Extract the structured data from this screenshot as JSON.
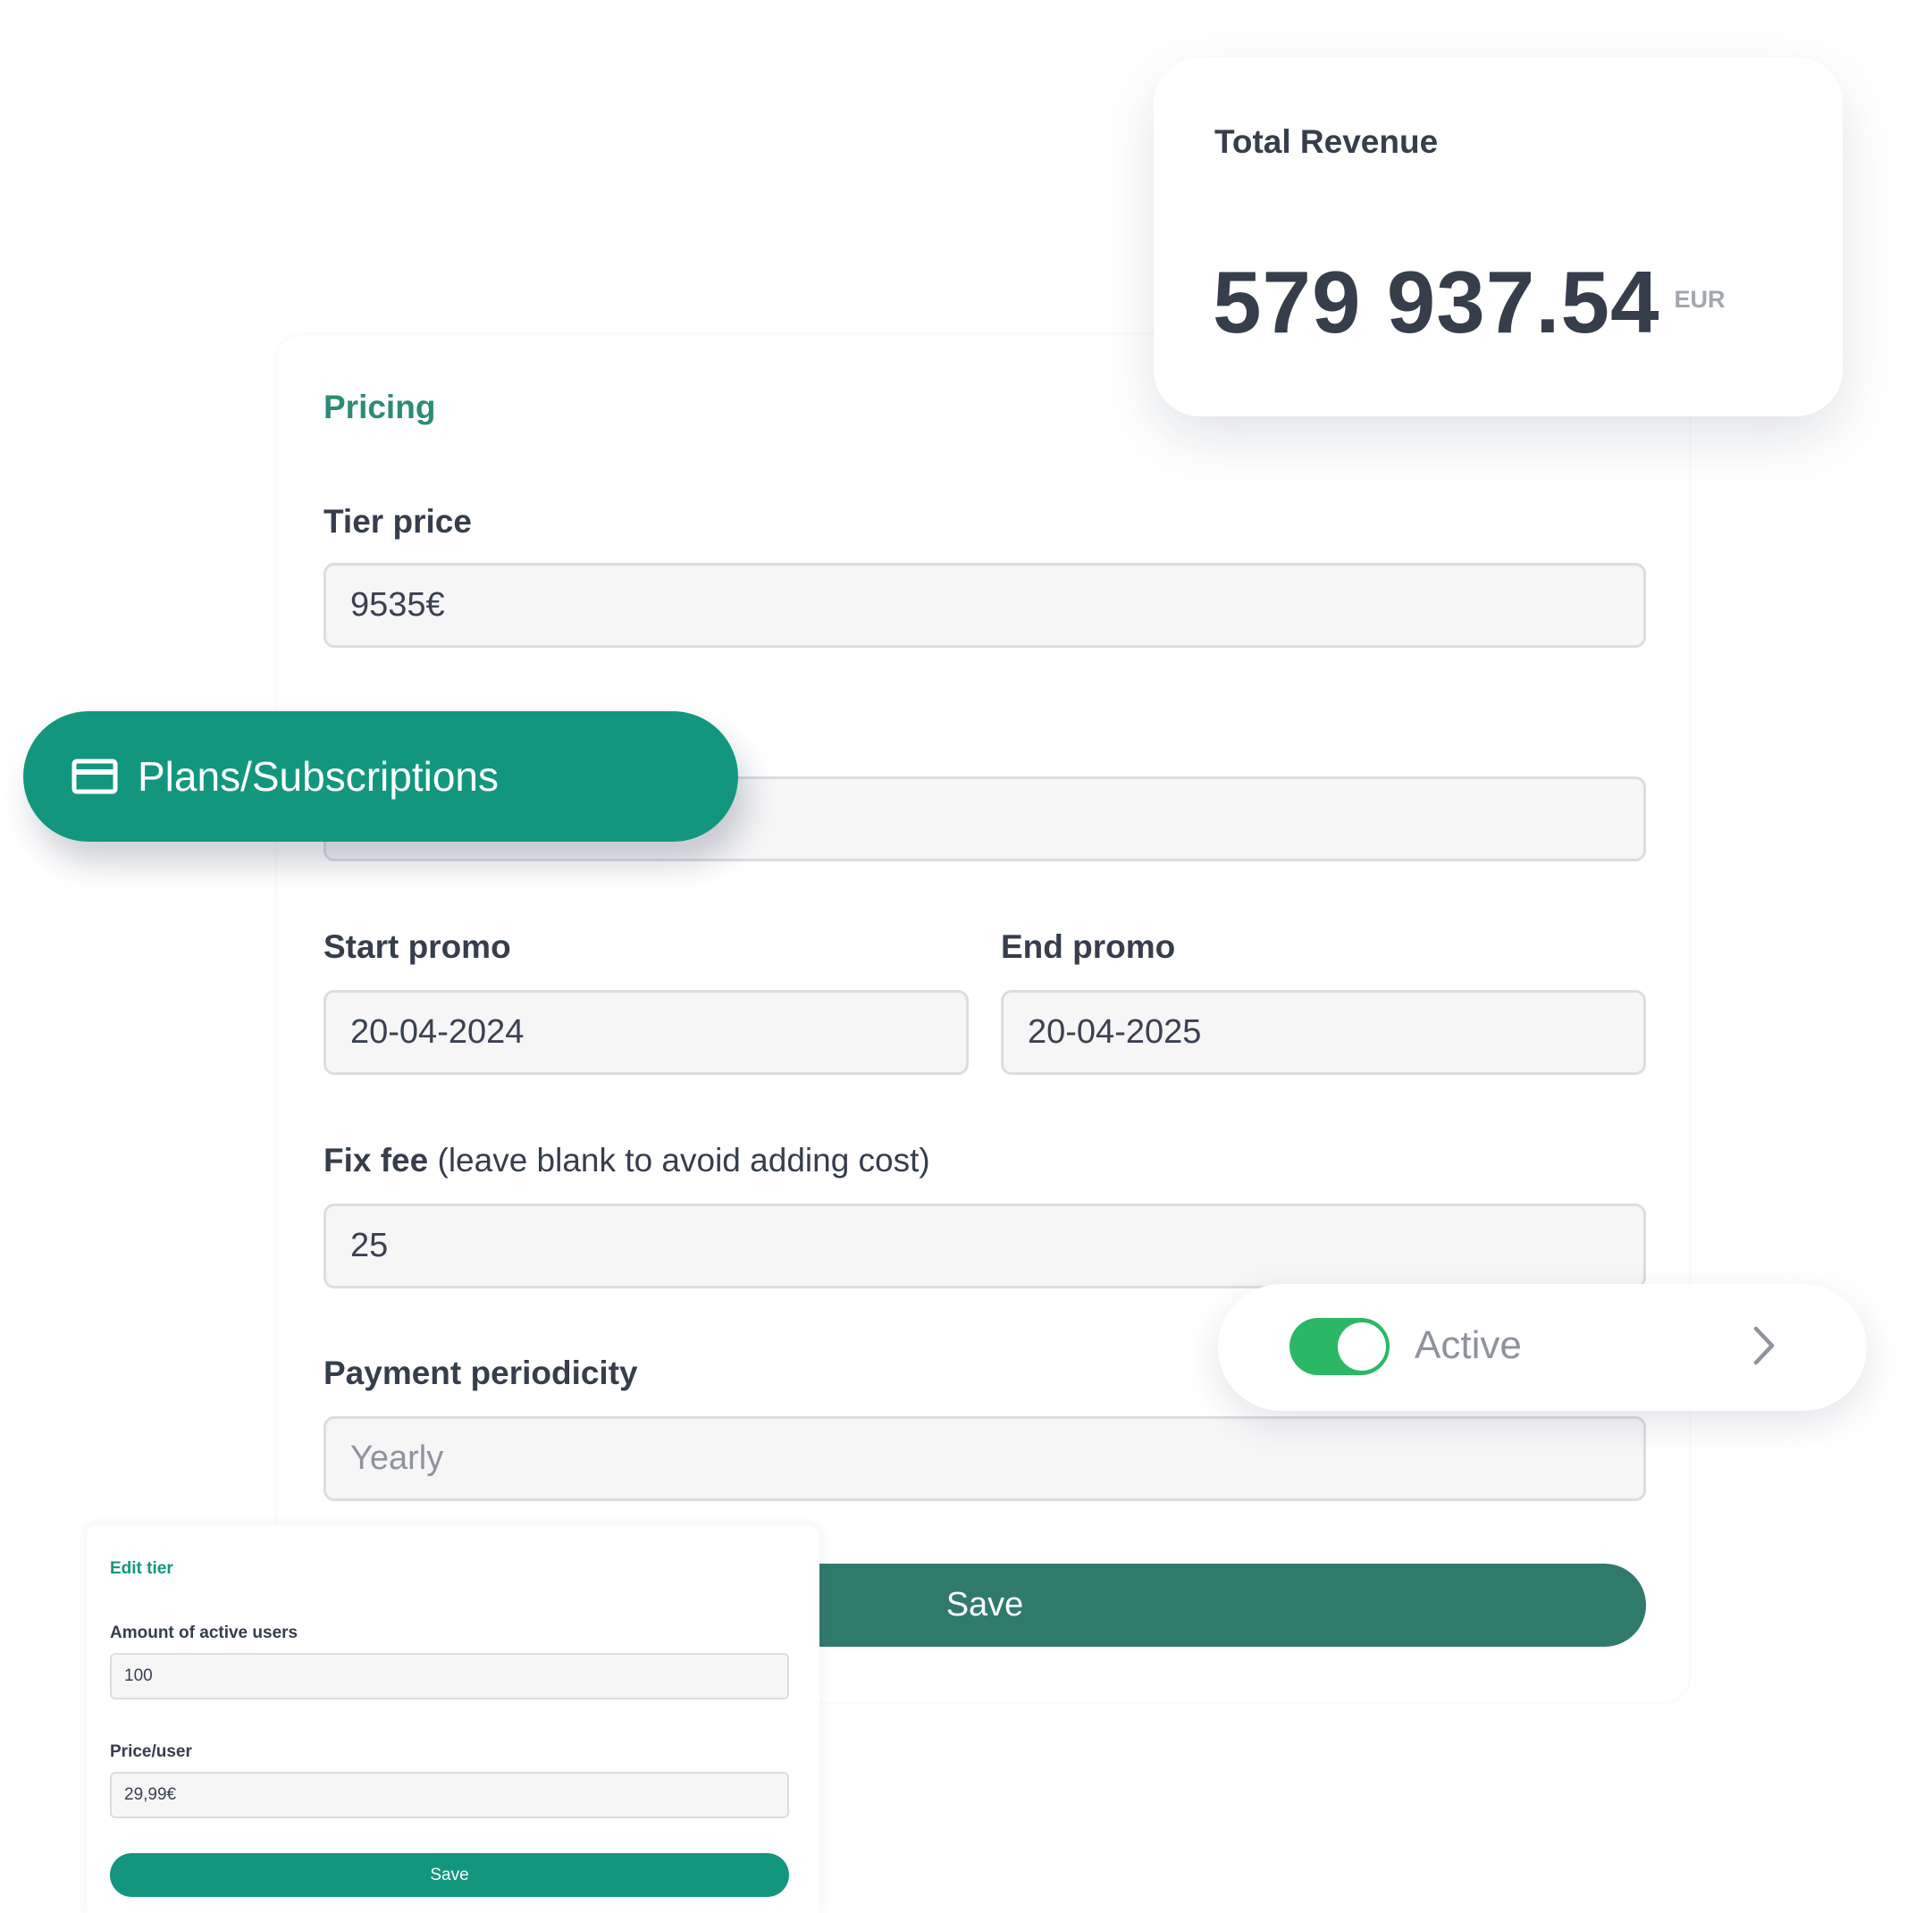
{
  "revenue": {
    "label": "Total Revenue",
    "amount": "579 937.54",
    "currency": "EUR"
  },
  "pricing": {
    "section_title": "Pricing",
    "tier_price_label": "Tier price",
    "tier_price_value": "9535€",
    "second_field_value": "",
    "start_promo_label": "Start promo",
    "start_promo_value": "20-04-2024",
    "end_promo_label": "End promo",
    "end_promo_value": "20-04-2025",
    "fix_fee_label": "Fix fee",
    "fix_fee_hint": "(leave blank to avoid adding cost)",
    "fix_fee_value": "25",
    "periodicity_label": "Payment periodicity",
    "periodicity_placeholder": "Yearly",
    "save_label": "Save"
  },
  "nav": {
    "plans_label": "Plans/Subscriptions",
    "plans_icon": "credit-card-icon"
  },
  "status": {
    "active_label": "Active",
    "toggle_on": true,
    "toggle_color": "#2bb866"
  },
  "edit_tier": {
    "title": "Edit tier",
    "users_label": "Amount of active users",
    "users_value": "100",
    "price_label": "Price/user",
    "price_value": "29,99€",
    "save_label": "Save"
  },
  "colors": {
    "brand_green": "#12977e",
    "save_dark_green": "#307a6c",
    "text": "#363e4c"
  }
}
